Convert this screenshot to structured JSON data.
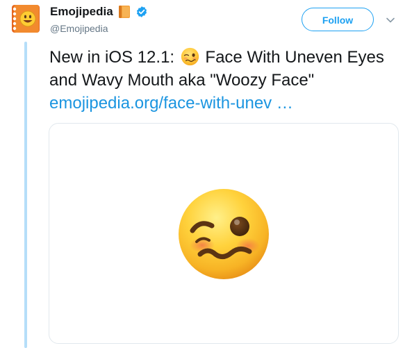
{
  "author": {
    "display_name": "Emojipedia",
    "handle": "@Emojipedia",
    "avatar_icon": "emojipedia-book-icon",
    "name_emoji_icon": "orange-book-icon",
    "verified": true
  },
  "actions": {
    "follow_label": "Follow",
    "menu_icon": "chevron-down-icon"
  },
  "tweet": {
    "text_before_emoji": "New in iOS 12.1: ",
    "text_after_emoji": " Face With Uneven Eyes and Wavy Mouth aka \"Woozy Face\" ",
    "link_text": "emojipedia.org/face-with-unev …",
    "inline_emoji_icon": "woozy-face-icon"
  },
  "media": {
    "image_icon": "woozy-face-icon"
  },
  "colors": {
    "accent": "#1da1f2",
    "link": "#1b95e0",
    "thread_line": "#b5def9",
    "secondary_text": "#657786",
    "card_border": "#e1e8ed"
  }
}
